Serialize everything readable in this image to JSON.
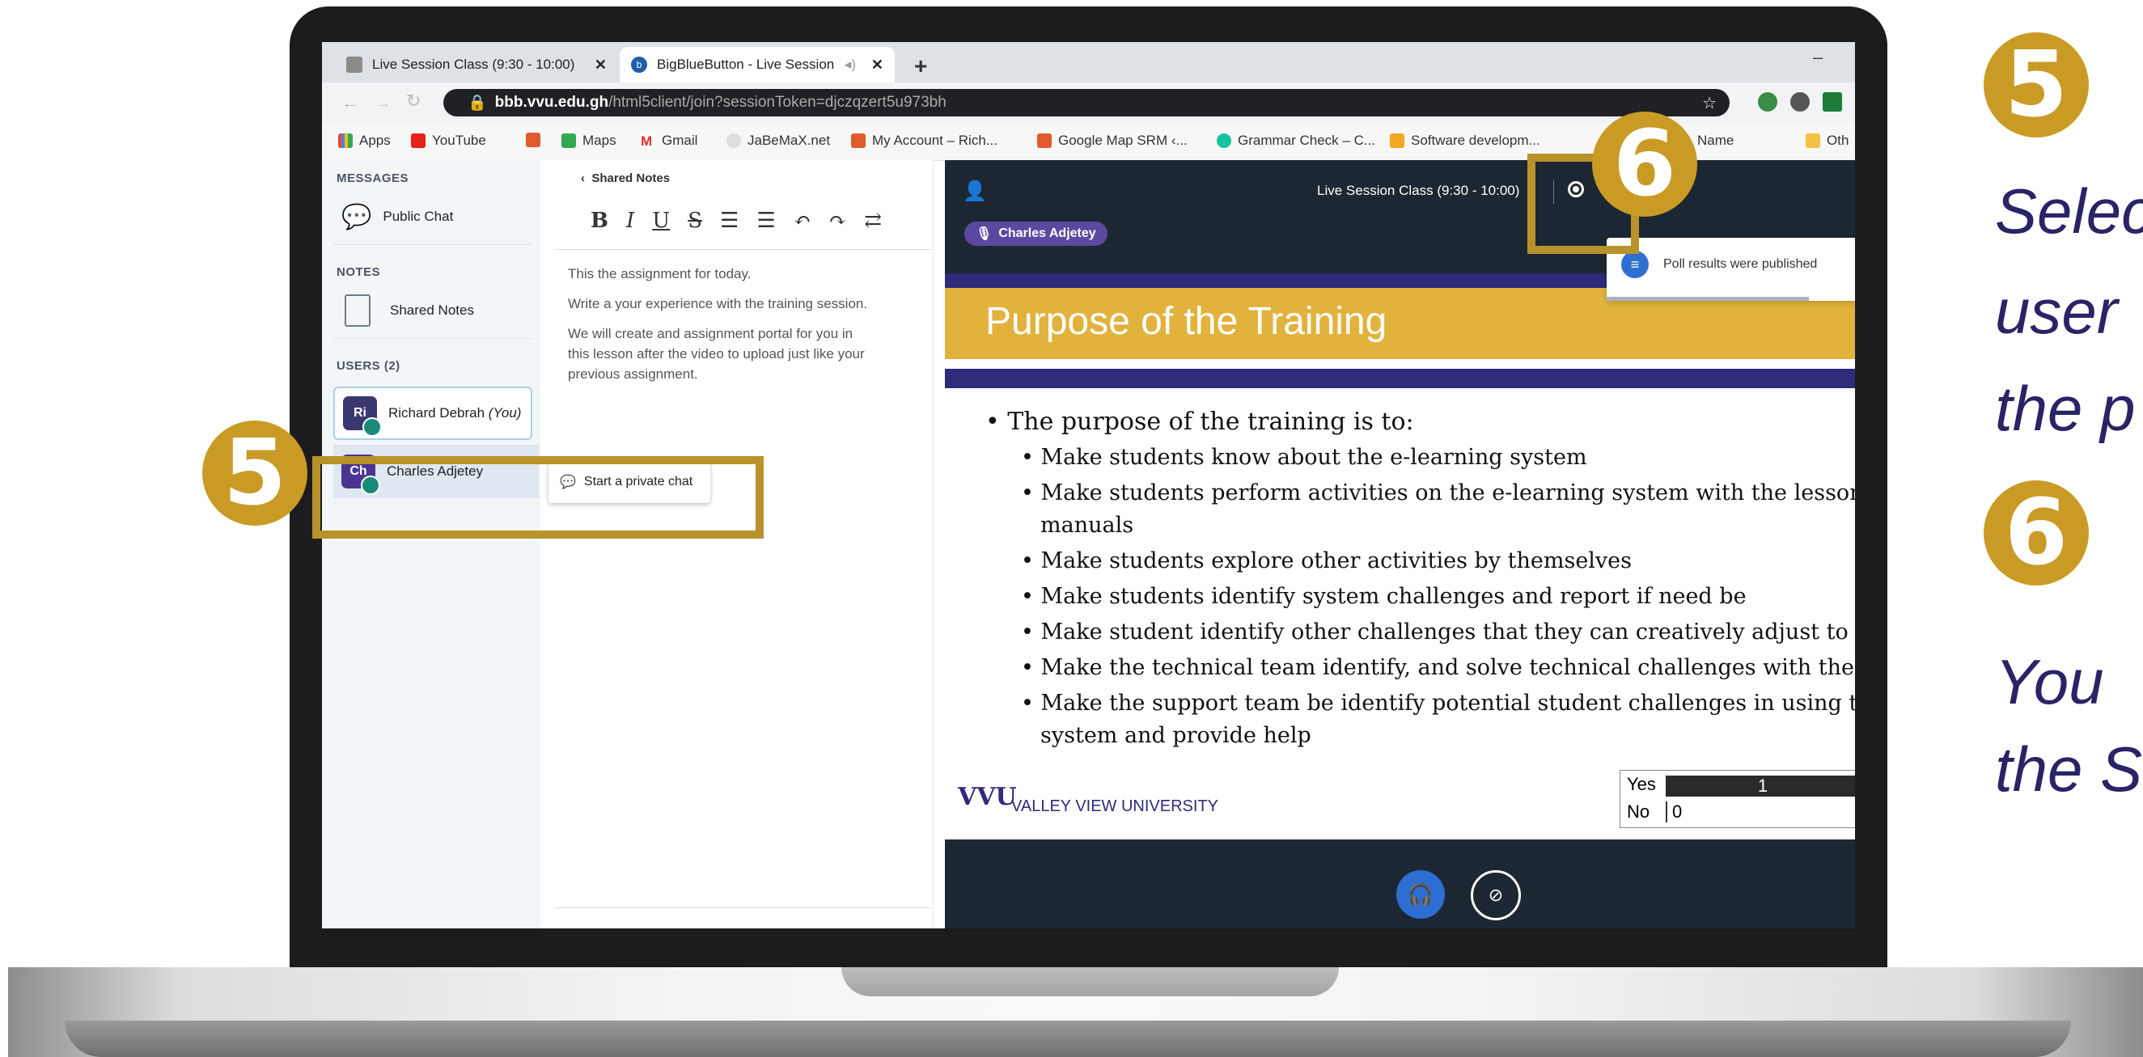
{
  "browser": {
    "tabs": [
      {
        "title": "Live Session Class (9:30 - 10:00)"
      },
      {
        "title": "BigBlueButton - Live Session"
      }
    ],
    "url_host": "bbb.vvu.edu.gh",
    "url_path": "/html5client/join?sessionToken=djczqzert5u973bh",
    "bookmarks": [
      "Apps",
      "YouTube",
      "Maps",
      "Gmail",
      "JaBeMaX.net",
      "My Account – Rich...",
      "Google Map SRM ‹...",
      "Grammar Check – C...",
      "Software developm...",
      "Name",
      "Oth"
    ]
  },
  "sidebar": {
    "messages_header": "MESSAGES",
    "public_chat": "Public Chat",
    "notes_header": "NOTES",
    "shared_notes": "Shared Notes",
    "users_header": "USERS (2)",
    "users": [
      {
        "initials": "Ri",
        "name": "Richard Debrah",
        "suffix": "(You)"
      },
      {
        "initials": "Ch",
        "name": "Charles Adjetey"
      }
    ],
    "private_chat": "Start a private chat"
  },
  "notes": {
    "back_label": "Shared Notes",
    "toolbar": [
      "B",
      "I",
      "U",
      "S"
    ],
    "paragraphs": [
      "This the assignment for today.",
      "Write a your experience with the training session.",
      "We will create and assignment portal for you in",
      "this lesson after the video to upload just like your",
      "previous assignment."
    ]
  },
  "stage": {
    "session_title": "Live Session Class (9:30 - 10:00)",
    "presenter": "Charles Adjetey",
    "toast": "Poll results were published",
    "slide": {
      "title": "Purpose of the Training",
      "lead": "The purpose of the training is to:",
      "bullets": [
        "Make students know about the e-learning system",
        "Make students perform activities on the e-learning system with the lesson",
        "manuals",
        "Make students explore other activities by themselves",
        "Make students identify system challenges and report if need be",
        "Make student identify other challenges that they can creatively adjust to",
        "Make the technical team identify, and solve technical challenges with the sys",
        "Make the support team be identify potential student challenges in using the",
        "system and provide help"
      ],
      "logo": "VVU",
      "university": "VALLEY VIEW UNIVERSITY",
      "poll": [
        {
          "label": "Yes",
          "value": "1"
        },
        {
          "label": "No",
          "value": "0"
        }
      ]
    }
  },
  "callouts": {
    "five": "5",
    "six": "6"
  },
  "right_panel": {
    "five_lines": [
      "Selec",
      "user",
      "the p"
    ],
    "six_lines": [
      "You",
      "the S"
    ]
  }
}
